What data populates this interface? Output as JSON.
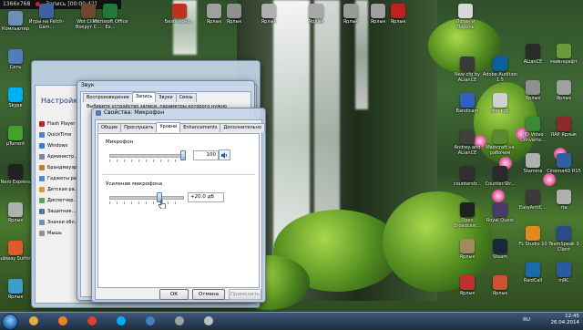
{
  "recorder": {
    "resolution": "1366x768",
    "status": "Запись [00:00:42]"
  },
  "desktop_icons_left": [
    {
      "label": "Компьютер",
      "color": "#6c8fb8"
    },
    {
      "label": "Сеть",
      "color": "#4f7fb6"
    },
    {
      "label": "Skype",
      "color": "#00aff0"
    },
    {
      "label": "µTorrent",
      "color": "#45a12a"
    },
    {
      "label": "Nero Express",
      "color": "#222222"
    },
    {
      "label": "Ярлык",
      "color": "#b0b0b0"
    },
    {
      "label": "Subway Surfers",
      "color": "#e05a2a"
    },
    {
      "label": "Ярлык",
      "color": "#3f9ccf"
    }
  ],
  "desktop_icons_top": [
    {
      "label": "Игры на Patch-Gam...",
      "color": "#4060a0"
    },
    {
      "label": "Wot Client Вокруг С...",
      "color": "#6a4a2a"
    },
    {
      "label": "Microsoft Office Ex...",
      "color": "#1f7a3a"
    },
    {
      "label": "Безопасно...",
      "color": "#c03020"
    },
    {
      "label": "Ярлык",
      "color": "#a0a0a0"
    },
    {
      "label": "Ярлык",
      "color": "#909090"
    },
    {
      "label": "Ярлык",
      "color": "#b0b0b0"
    },
    {
      "label": "Ярлык",
      "color": "#a8a8a8"
    },
    {
      "label": "Ярлык",
      "color": "#9a9a9a"
    },
    {
      "label": "Ярлык",
      "color": "#a0a0a0"
    },
    {
      "label": "Ярлык",
      "color": "#c02020"
    },
    {
      "label": "Логин и Пароль",
      "color": "#d8d8d8"
    }
  ],
  "desktop_icons_right": [
    {
      "label": "New cfg by ALianCE",
      "color": "#3a3a3a"
    },
    {
      "label": "Adobe Audition 1.5",
      "color": "#0a5fa0"
    },
    {
      "label": "Bandicam",
      "color": "#3060c0"
    },
    {
      "label": "мой кфг",
      "color": "#d0d0d0"
    },
    {
      "label": "Andrey and ALianCE",
      "color": "#404040"
    },
    {
      "label": "Maincraft на рабочем",
      "color": "#5a8a30"
    },
    {
      "label": "counterstr...",
      "color": "#303030"
    },
    {
      "label": "Counter-Str...",
      "color": "#2a2a2a"
    },
    {
      "label": "Open Broadcast...",
      "color": "#202020"
    },
    {
      "label": "Royal Quest",
      "color": "#4a3a6a"
    },
    {
      "label": "Ярлык",
      "color": "#a08a60"
    },
    {
      "label": "Steam",
      "color": "#1b2838"
    },
    {
      "label": "Ярлык",
      "color": "#c03030"
    },
    {
      "label": "Ярлык",
      "color": "#d05030"
    }
  ],
  "desktop_icons_far_right": [
    {
      "label": "ALianCE",
      "color": "#2a2a2a"
    },
    {
      "label": "майнкрафт",
      "color": "#6a9a3a"
    },
    {
      "label": "Ярлык",
      "color": "#909090"
    },
    {
      "label": "Ярлык",
      "color": "#a0a0a0"
    },
    {
      "label": "HD Video Converte...",
      "color": "#3a8a3a"
    },
    {
      "label": "RAP Ярлык",
      "color": "#8a2a2a"
    },
    {
      "label": "Staminа",
      "color": "#b0b0b0"
    },
    {
      "label": "Cinema4D R15",
      "color": "#3060a0"
    },
    {
      "label": "EasyAntiC...",
      "color": "#3a3a3a"
    },
    {
      "label": "rta",
      "color": "#b0b0b0"
    },
    {
      "label": "FL Studio 10",
      "color": "#e08a20"
    },
    {
      "label": "TeamSpeak 3 Client",
      "color": "#2a4a8a"
    },
    {
      "label": "RaidCall",
      "color": "#1a6ab0"
    },
    {
      "label": "mRC",
      "color": "#2a5aa0"
    }
  ],
  "control_panel": {
    "title": "Настройка",
    "items": [
      {
        "label": "Flash Player",
        "color": "#c02020"
      },
      {
        "label": "QuickTime",
        "color": "#5080c0"
      },
      {
        "label": "Windows",
        "color": "#3080d0"
      },
      {
        "label": "Администр...",
        "color": "#8080a0"
      },
      {
        "label": "Брандмауэр",
        "color": "#c08030"
      },
      {
        "label": "Гаджеты ра...",
        "color": "#4a8ad0"
      },
      {
        "label": "Детская ра...",
        "color": "#d0a030"
      },
      {
        "label": "Диспетчер...",
        "color": "#60a060"
      },
      {
        "label": "Защитник...",
        "color": "#5070a0"
      },
      {
        "label": "Значки обл...",
        "color": "#7090b0"
      },
      {
        "label": "Мышь",
        "color": "#909090"
      }
    ]
  },
  "sound_dialog": {
    "title": "Звук",
    "tabs": [
      "Воспроизведение",
      "Запись",
      "Звуки",
      "Связь"
    ],
    "active_tab": 1,
    "instruction": "Выберите устройство записи, параметры которого нужно"
  },
  "mic_dialog": {
    "title": "Свойства: Микрофон",
    "tabs": [
      "Общие",
      "Прослушать",
      "Уровни",
      "Enhancements",
      "Дополнительно"
    ],
    "active_tab": 2,
    "microphone": {
      "label": "Микрофон",
      "value": "100",
      "level": 1.0
    },
    "boost": {
      "label": "Усиление микрофона",
      "value": "+20.0 дБ",
      "level": 0.67
    },
    "buttons": {
      "ok": "ОК",
      "cancel": "Отмена",
      "apply": "Применить"
    }
  },
  "taskbar": {
    "apps": [
      {
        "name": "explorer",
        "color": "#e0b040"
      },
      {
        "name": "media-player",
        "color": "#f08020"
      },
      {
        "name": "chrome",
        "color": "#e04030"
      },
      {
        "name": "skype",
        "color": "#00aff0"
      },
      {
        "name": "app",
        "color": "#4080c0"
      },
      {
        "name": "app",
        "color": "#a0a0a0"
      },
      {
        "name": "app",
        "color": "#c0c0c0"
      }
    ],
    "language": "RU",
    "time": "12:45",
    "date": "26.04.2014"
  }
}
